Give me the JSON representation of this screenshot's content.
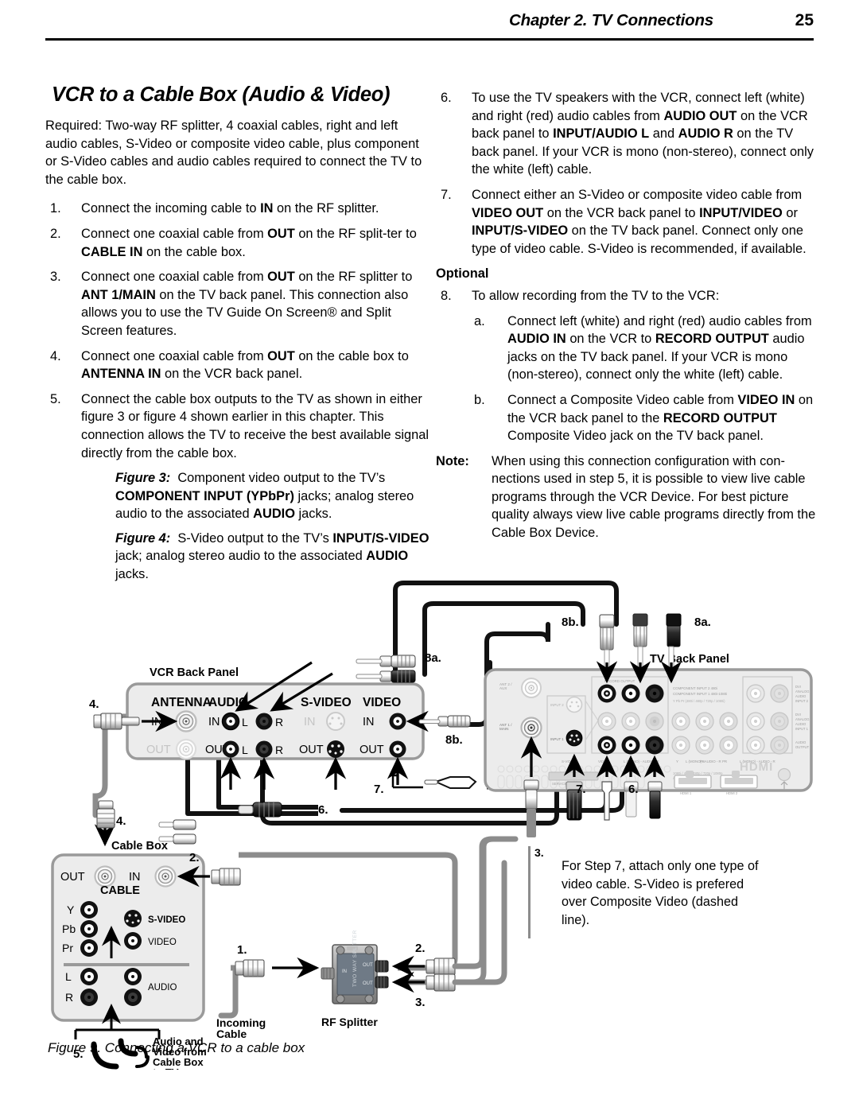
{
  "header": {
    "chapter_title": "Chapter 2. TV Connections",
    "page_number": "25"
  },
  "section": {
    "title": "VCR to a Cable Box (Audio & Video)",
    "intro": "Required:  Two-way RF splitter, 4 coaxial cables, right and left audio cables, S-Video or composite video cable, plus component or S-Video cables and audio cables required to connect the TV to the cable box."
  },
  "left_column": {
    "steps": [
      {
        "num": "1.",
        "html": "Connect the incoming cable to <b>IN</b> on the RF splitter."
      },
      {
        "num": "2.",
        "html": "Connect one coaxial cable from <b>OUT</b> on the RF split-ter to <b>CABLE IN</b> on the cable box."
      },
      {
        "num": "3.",
        "html": "Connect one coaxial cable from <b>OUT</b> on the RF splitter to <b>ANT 1/MAIN</b> on the TV back panel.  This connection also allows you to use the TV Guide On Screen&reg; and Split Screen features."
      },
      {
        "num": "4.",
        "html": "Connect one coaxial cable from <b>OUT</b> on the cable box to <b>ANTENNA IN</b> on the VCR back panel."
      },
      {
        "num": "5.",
        "html": "Connect the cable box outputs to the TV as shown in either figure 3 or figure 4 shown earlier in this chapter.  This connection allows the TV to receive the best available signal directly from the cable box."
      }
    ],
    "figure_notes": [
      {
        "label": "Figure 3:",
        "html": "&nbsp; Component video output to the TV&rsquo;s <b>COMPONENT INPUT (YPbPr)</b> jacks; analog stereo audio to the associated <b>AUDIO</b> jacks."
      },
      {
        "label": "Figure 4:",
        "html": "&nbsp; S-Video output to the TV&rsquo;s <b>INPUT/S-VIDEO</b> jack; analog stereo audio to the associated <b>AUDIO</b> jacks."
      }
    ]
  },
  "right_column": {
    "steps": [
      {
        "num": "6.",
        "html": "To use the TV speakers with the VCR, connect left (white) and right (red) audio cables from <b>AUDIO OUT</b> on the VCR back panel to <b>INPUT/AUDIO L</b> and <b>AUDIO R</b> on the TV back panel.  If your VCR is mono (non-stereo), connect only the white (left) cable."
      },
      {
        "num": "7.",
        "html": "Connect either an S-Video or composite video cable from <b>VIDEO OUT</b> on the VCR back panel to <b>INPUT/VIDEO</b> or <b>INPUT/S-VIDEO</b> on the TV back panel.  Connect only one type of video cable.  S-Video is recommended, if available."
      }
    ],
    "optional_heading": "Optional",
    "step8": {
      "num": "8.",
      "html": "To allow recording from the TV to the VCR:"
    },
    "substeps": [
      {
        "num": "a.",
        "html": "Connect left (white) and right (red) audio cables from <b>AUDIO IN</b> on the VCR to <b>RECORD OUTPUT</b> audio jacks on the TV back panel.  If your VCR is mono (non-stereo), connect only the white (left) cable."
      },
      {
        "num": "b.",
        "html": "Connect a Composite Video cable from <b>VIDEO IN</b> on the VCR back panel to the <b>RECORD OUTPUT</b> Composite Video jack on the TV back panel."
      }
    ],
    "note": {
      "label": "Note:",
      "html": "When using this connection configuration with con-nections used in step 5, it is possible to view live cable programs through the VCR Device.  For best picture quality always view live cable programs directly from the Cable Box Device."
    }
  },
  "diagram": {
    "caption": "Figure 9.  Connecting a VCR to a cable box",
    "vcr_panel": {
      "title": "VCR Back Panel",
      "group_antenna": "ANTENNA",
      "group_audio": "AUDIO",
      "group_svideo": "S-VIDEO",
      "group_video": "VIDEO",
      "row_in": "IN",
      "row_out": "OUT",
      "left_label": "L",
      "right_label": "R"
    },
    "tv_panel": {
      "title": "TV Back Panel",
      "micro_labels": {
        "ant2": "ANT 2 / AUX",
        "ant1": "ANT 1 / MAIN",
        "input2": "INPUT 2",
        "input1": "INPUT 1",
        "svideo": "S-VIDEO",
        "video": "VIDEO",
        "audio_l_r": "L  (MONO) - AUDIO - R",
        "record_output": "RECORD OUTPUT",
        "component1": "COMPONENT INPUT 2  480i",
        "component2": "COMPONENT INPUT 1  480i-1080i",
        "component3": "Y Pb Pr (480i / 480p / 720p / 1080i)",
        "y": "Y",
        "pb": "PB",
        "pr": "PR",
        "dvi_audio2": "DVI ANALOG AUDIO INPUT 2",
        "dvi_audio1": "DVI ANALOG AUDIO INPUT 1",
        "audio_output": "AUDIO OUTPUT",
        "service_port": "SERVICE PORT",
        "hdmi_spec": "1080i / 480i / 480p / 720p / 1080p   AUDIO PCM",
        "hdmi_logo": "HDMI",
        "hdmi1": "HDMI 1",
        "hdmi2": "HDMI 2"
      }
    },
    "cable_box": {
      "title": "Cable Box",
      "out": "OUT",
      "in": "IN",
      "cable": "CABLE",
      "y": "Y",
      "pb": "Pb",
      "pr": "Pr",
      "l": "L",
      "r": "R",
      "svideo": "S-VIDEO",
      "video": "VIDEO",
      "audio": "AUDIO"
    },
    "rf_splitter": {
      "title": "RF Splitter",
      "incoming_cable": "Incoming\nCable",
      "incoming_line1": "Incoming",
      "incoming_line2": "Cable",
      "body_text": "TWO WAY SPLITTER",
      "in": "IN",
      "out_top": "OUT",
      "out_bottom": "OUT"
    },
    "callouts": {
      "c1": "1.",
      "c2": "2.",
      "c2b": "2.",
      "c3": "3.",
      "c3b": "3.",
      "c4": "4.",
      "c4b": "4.",
      "c5": "5.",
      "c6": "6.",
      "c6b": "6.",
      "c7": "7.",
      "c7b": "7.",
      "c7c": "7.",
      "c8a": "8a.",
      "c8a2": "8a.",
      "c8b": "8b.",
      "c8b2": "8b."
    },
    "cable_box_to_tv_label": {
      "line1": "Audio and",
      "line2": "Video from",
      "line3": "Cable Box",
      "line4": "to TV"
    },
    "note_box": {
      "num": "3.",
      "text": "For Step 7, attach only one type of video cable. S-Video is prefered over Composite Video (dashed line)."
    }
  },
  "colors": {
    "ink": "#000000",
    "panel_fill": "#ececec",
    "panel_stroke": "#9a9a9a",
    "cable_grey": "#8c8c8c",
    "micro_text": "#b8b8b8"
  }
}
